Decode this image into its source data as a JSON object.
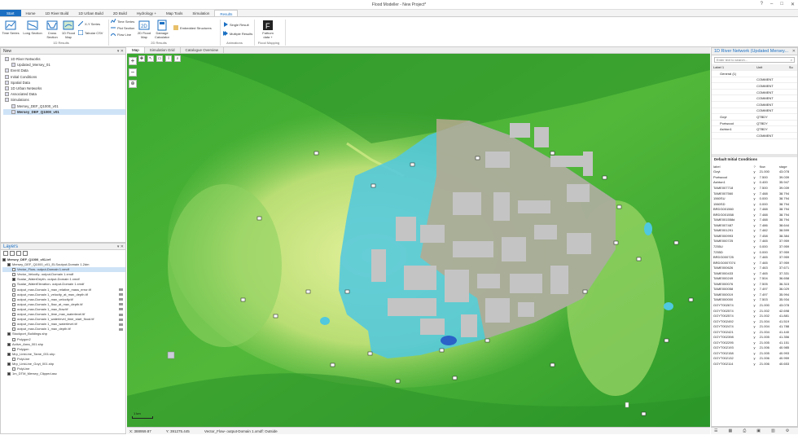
{
  "app": {
    "title": "Flood Modeller - New Project*"
  },
  "tabs": [
    {
      "label": "Start"
    },
    {
      "label": "Home"
    },
    {
      "label": "1D River Build"
    },
    {
      "label": "1D Urban Build"
    },
    {
      "label": "2D Build"
    },
    {
      "label": "Hydrology +"
    },
    {
      "label": "Map Tools"
    },
    {
      "label": "Simulation"
    },
    {
      "label": "Results"
    }
  ],
  "ribbon": {
    "time_series": "Time Series",
    "long_section": "Long Section",
    "cross_section": "Cross Section",
    "flood_map_1d": "1D Flood Map",
    "xy_series": "X-Y Series",
    "tabular_csv": "Tabular CSV",
    "group_1d": "1D Results",
    "time_series_2d": "Time Series",
    "plot_section": "Plot Section",
    "flow_line": "Flow Line",
    "flood_map_2d": "2D Flood Map",
    "damage_calculator": "Damage Calculator",
    "embedded_structures": "Embedded Structures",
    "group_2d": "2D Results",
    "single_result": "Single Result",
    "multiple_results": "Multiple Results",
    "group_anim": "Animations",
    "fathom": "Fathom data +",
    "group_fm": "Flood Mapping"
  },
  "tree": {
    "title": "New",
    "items": [
      {
        "label": "1D River Networks"
      },
      {
        "label": "Updated_Mersey_01"
      },
      {
        "label": "Event Data"
      },
      {
        "label": "Initial Conditions"
      },
      {
        "label": "Spatial Data"
      },
      {
        "label": "1D Urban Networks"
      },
      {
        "label": "Associated Data"
      },
      {
        "label": "Simulations"
      },
      {
        "label": "Mersey_DEF_Q1000_v01"
      },
      {
        "label": "Mersey_DEF_Q1000_v01"
      }
    ]
  },
  "layers": {
    "title": "Layers",
    "items": [
      {
        "label": "Mersey_DEF_Q1000_v01.ief",
        "on": true
      },
      {
        "label": "Mersey_DEF_Q1000_v01_ELSoutput-Domain 1.2dm",
        "on": true
      },
      {
        "label": "Vector_Flow- output-Domain 1.xmdf",
        "on": false
      },
      {
        "label": "Vector_Velocity- output-Domain 1.xmdf",
        "on": false
      },
      {
        "label": "Scalar_WaterDepth- output-Domain 1.xmdf",
        "on": true
      },
      {
        "label": "Scalar_WaterElevation- output-Domain 1.xmdf",
        "on": false
      },
      {
        "label": "output_max-Domain 1_max_relative_mass_error.tif",
        "on": false
      },
      {
        "label": "output_max-Domain 1_velocity_at_max_depth.tif",
        "on": false
      },
      {
        "label": "output_max-Domain 1_max_velocity.tif",
        "on": false
      },
      {
        "label": "output_max-Domain 1_flow_at_max_depth.tif",
        "on": false
      },
      {
        "label": "output_max-Domain 1_max_flow.tif",
        "on": false
      },
      {
        "label": "output_max-Domain 1_time_max_waterlevel.tif",
        "on": false
      },
      {
        "label": "output_max-Domain 1_waterlevel_time_start_flood.tif",
        "on": false
      },
      {
        "label": "output_max-Domain 1_max_waterlevel.tif",
        "on": false
      },
      {
        "label": "output_max-Domain 1_max_depth.tif",
        "on": false
      },
      {
        "label": "Stockport_Buildings.shp",
        "on": true
      },
      {
        "label": "Polygon2",
        "on": false
      },
      {
        "label": "Active_Area_001.shp",
        "on": true
      },
      {
        "label": "Polygon",
        "on": false
      },
      {
        "label": "Mrp_LinkLine_Tame_001.shp",
        "on": true
      },
      {
        "label": "PolyLine",
        "on": false
      },
      {
        "label": "Mrp_LinkLine_Goyt_001.shp",
        "on": true
      },
      {
        "label": "PolyLine",
        "on": false
      },
      {
        "label": "1m_DTM_Mersey_Clipped.asc",
        "on": true
      }
    ]
  },
  "map": {
    "tabs": [
      {
        "label": "Map"
      },
      {
        "label": "Simulation Grid"
      },
      {
        "label": "Catalogue Overview"
      }
    ],
    "scale_label": "1 km"
  },
  "status": {
    "x": "X:  388959.87",
    "y": "Y:  391275.445",
    "msg": "Vector_Flow- output-Domain 1.xmdf: Outside"
  },
  "network": {
    "title": "1D River Network (Updated Mersey...",
    "search_placeholder": "Enter text to search...",
    "cols": [
      "Label 1",
      "Unit",
      "Su"
    ],
    "rows": [
      {
        "label": "General (1)",
        "unit": ""
      },
      {
        "label": "",
        "unit": "COMMENT"
      },
      {
        "label": "",
        "unit": "COMMENT"
      },
      {
        "label": "",
        "unit": "COMMENT"
      },
      {
        "label": "",
        "unit": "COMMENT"
      },
      {
        "label": "",
        "unit": "COMMENT"
      },
      {
        "label": "",
        "unit": "COMMENT"
      },
      {
        "label": "Goyt",
        "unit": "QTBDY"
      },
      {
        "label": "Portwood",
        "unit": "QTBDY"
      },
      {
        "label": "Ashton1",
        "unit": "QTBDY"
      },
      {
        "label": "",
        "unit": "COMMENT"
      }
    ]
  },
  "ic": {
    "title": "Default Initial Conditions",
    "cols": [
      "label",
      "?",
      "flow",
      "stage"
    ],
    "rows": [
      [
        "Goyt",
        "y",
        "21.000",
        "43.078"
      ],
      [
        "Portwood",
        "y",
        "7.500",
        "39.039"
      ],
      [
        "Ashton1",
        "y",
        "0.400",
        "35.947"
      ],
      [
        "TAME007718",
        "y",
        "7.500",
        "39.039"
      ],
      [
        "TAME007560",
        "y",
        "7.488",
        "38.794"
      ],
      [
        "1560SU",
        "y",
        "0.000",
        "38.794"
      ],
      [
        "1560SD",
        "y",
        "0.000",
        "38.794"
      ],
      [
        "BRDG001560",
        "y",
        "7.488",
        "38.794"
      ],
      [
        "BRDG001558",
        "y",
        "7.488",
        "38.794"
      ],
      [
        "TAME001558d",
        "y",
        "7.488",
        "38.794"
      ],
      [
        "TAME007487",
        "y",
        "7.486",
        "38.644"
      ],
      [
        "TAME001291",
        "y",
        "7.482",
        "38.599"
      ],
      [
        "TAME000993",
        "y",
        "7.458",
        "38.384"
      ],
      [
        "TAME000725",
        "y",
        "7.465",
        "37.959"
      ],
      [
        "7255U",
        "y",
        "0.000",
        "37.959"
      ],
      [
        "7255D",
        "y",
        "0.000",
        "37.959"
      ],
      [
        "BRDG000725",
        "y",
        "7.465",
        "37.959"
      ],
      [
        "BRDG0007074",
        "y",
        "7.465",
        "37.959"
      ],
      [
        "TAME000626",
        "y",
        "7.463",
        "37.671"
      ],
      [
        "TAME000433",
        "y",
        "7.465",
        "37.331"
      ],
      [
        "TAME000249",
        "y",
        "7.504",
        "36.658"
      ],
      [
        "TAME000076",
        "y",
        "7.505",
        "36.315"
      ],
      [
        "TAME000058",
        "y",
        "7.497",
        "36.029"
      ],
      [
        "TAME000019",
        "y",
        "7.497",
        "35.994"
      ],
      [
        "TAME000000",
        "y",
        "7.503",
        "35.934"
      ],
      [
        "GOYT002674",
        "y",
        "21.000",
        "43.078"
      ],
      [
        "GOYT002574",
        "y",
        "21.002",
        "42.698"
      ],
      [
        "GOYT002574",
        "y",
        "21.002",
        "41.881"
      ],
      [
        "GOYT002492",
        "y",
        "21.004",
        "41.519"
      ],
      [
        "GOYT002474",
        "y",
        "21.004",
        "41.788"
      ],
      [
        "GOYT002421",
        "y",
        "21.004",
        "41.440"
      ],
      [
        "GOYT002398",
        "y",
        "21.005",
        "41.356"
      ],
      [
        "GOYT002295",
        "y",
        "21.005",
        "41.151"
      ],
      [
        "GOYT002193",
        "y",
        "21.006",
        "40.985"
      ],
      [
        "GOYT002158",
        "y",
        "21.005",
        "40.993"
      ],
      [
        "GOYT002132",
        "y",
        "21.006",
        "40.959"
      ],
      [
        "GOYT002114",
        "y",
        "21.006",
        "40.653"
      ]
    ]
  },
  "colors": {
    "accent": "#1b6fc2",
    "terrain_high": "#2f9a2a",
    "terrain_low": "#bfe07a",
    "flood": "#4fc8e0",
    "buildings": "#c4c4c4"
  }
}
